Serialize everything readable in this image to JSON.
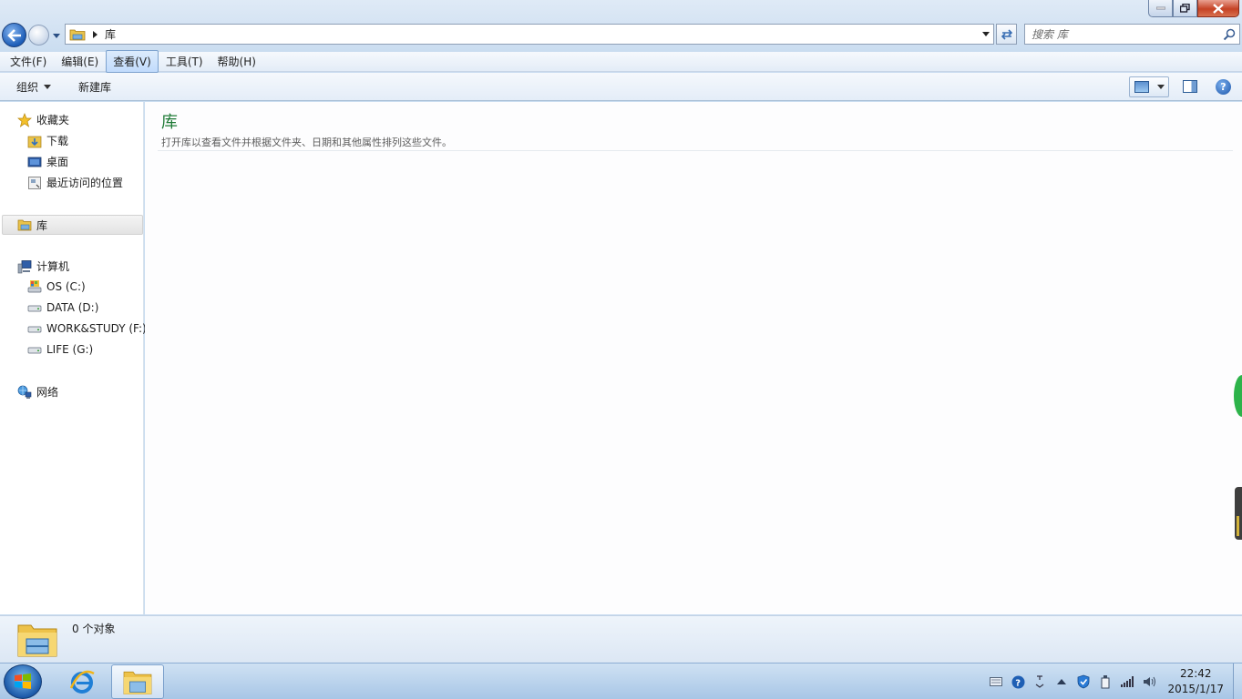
{
  "window": {
    "address_location": "库",
    "search_placeholder": "搜索 库"
  },
  "menu": {
    "items": [
      "文件(F)",
      "编辑(E)",
      "查看(V)",
      "工具(T)",
      "帮助(H)"
    ],
    "active": "查看(V)"
  },
  "commands": {
    "organize": "组织",
    "new_library": "新建库"
  },
  "nav": {
    "favorites": "收藏夹",
    "downloads": "下载",
    "desktop": "桌面",
    "recent": "最近访问的位置",
    "libraries": "库",
    "computer": "计算机",
    "drive_c": "OS (C:)",
    "drive_d": "DATA (D:)",
    "drive_f": "WORK&STUDY (F:)",
    "drive_g": "LIFE (G:)",
    "network": "网络"
  },
  "content": {
    "title": "库",
    "description": "打开库以查看文件并根据文件夹、日期和其他属性排列这些文件。"
  },
  "details": {
    "count": "0 个对象"
  },
  "taskbar": {
    "time": "22:42",
    "date": "2015/1/17"
  },
  "colors": {
    "title_green": "#1e7a36",
    "accent_blue": "#1d5db8"
  },
  "icons": {
    "back": "back-arrow-icon",
    "forward": "forward-arrow-icon",
    "refresh": "refresh-icon",
    "search": "search-icon",
    "help": "help-icon"
  }
}
